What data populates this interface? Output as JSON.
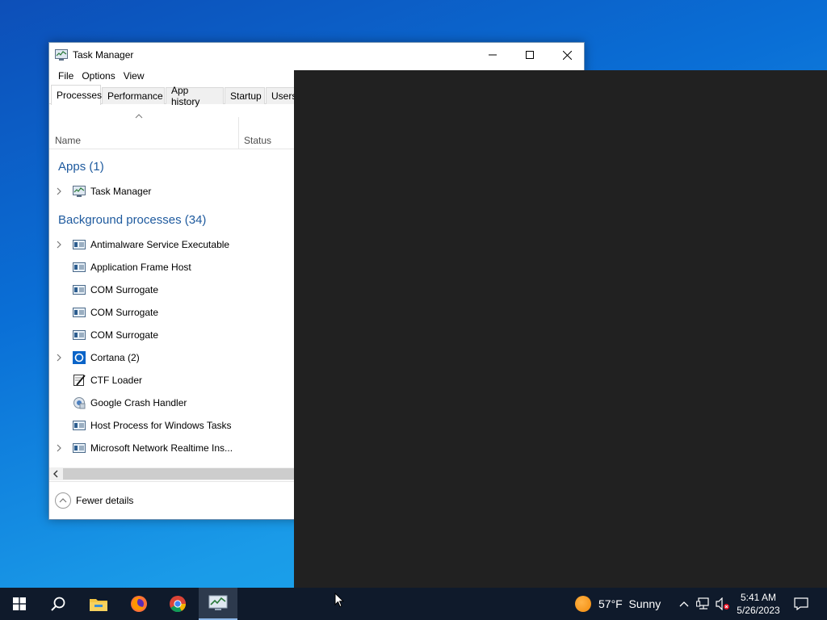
{
  "window": {
    "title": "Task Manager",
    "menu": [
      "File",
      "Options",
      "View"
    ],
    "tabs": [
      "Processes",
      "Performance",
      "App history",
      "Startup",
      "Users"
    ],
    "active_tab": "Processes"
  },
  "columns": {
    "name": "Name",
    "status": "Status"
  },
  "groups": {
    "apps": "Apps (1)",
    "background": "Background processes (34)"
  },
  "apps": [
    {
      "name": "Task Manager",
      "expandable": true,
      "icon": "task-manager-icon"
    }
  ],
  "background": [
    {
      "name": "Antimalware Service Executable",
      "expandable": true,
      "icon": "service-icon"
    },
    {
      "name": "Application Frame Host",
      "expandable": false,
      "icon": "service-icon"
    },
    {
      "name": "COM Surrogate",
      "expandable": false,
      "icon": "service-icon"
    },
    {
      "name": "COM Surrogate",
      "expandable": false,
      "icon": "service-icon"
    },
    {
      "name": "COM Surrogate",
      "expandable": false,
      "icon": "service-icon"
    },
    {
      "name": "Cortana (2)",
      "expandable": true,
      "icon": "cortana-icon"
    },
    {
      "name": "CTF Loader",
      "expandable": false,
      "icon": "ctf-loader-icon"
    },
    {
      "name": "Google Crash Handler",
      "expandable": false,
      "icon": "google-crash-icon"
    },
    {
      "name": "Host Process for Windows Tasks",
      "expandable": false,
      "icon": "service-icon"
    },
    {
      "name": "Microsoft Network Realtime Ins...",
      "expandable": true,
      "icon": "service-icon"
    }
  ],
  "footer": {
    "fewer_details": "Fewer details"
  },
  "taskbar": {
    "weather_temp": "57°F",
    "weather_desc": "Sunny",
    "time": "5:41 AM",
    "date": "5/26/2023"
  },
  "colors": {
    "accent": "#1e5a9e",
    "overlay": "#212121",
    "taskbar": "#0f1a2b"
  }
}
